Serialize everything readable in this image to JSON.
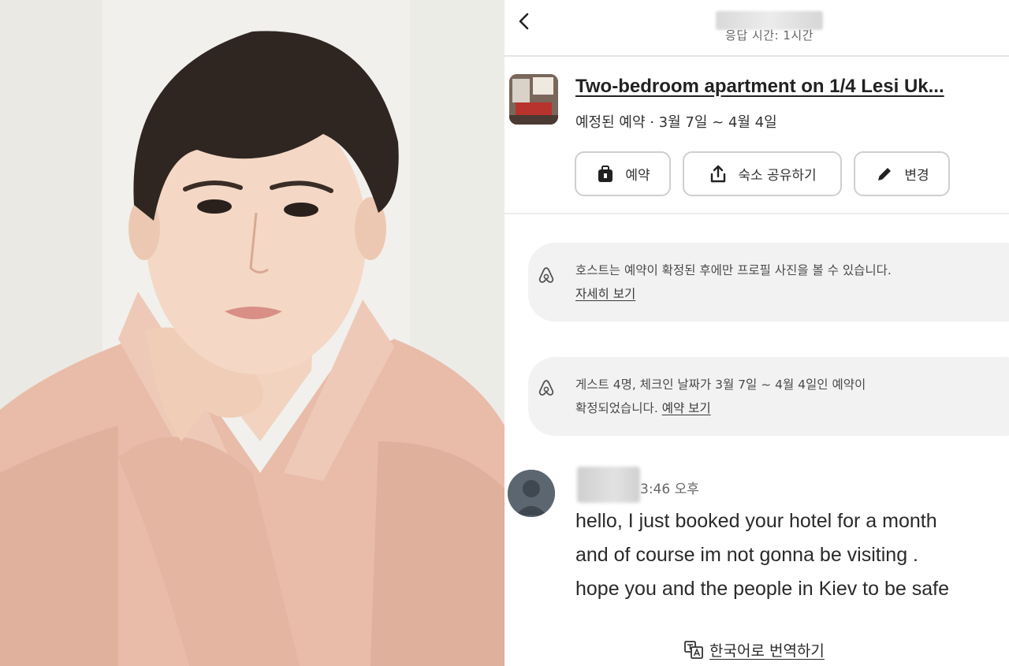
{
  "chat": {
    "response_time": "응답 시간: 1시간",
    "listing": {
      "title": "Two-bedroom apartment on 1/4 Lesi Uk...",
      "subtitle": "예정된 예약 · 3월 7일 ~ 4월 4일"
    },
    "actions": {
      "reserve_label": "예약",
      "share_label": "숙소 공유하기",
      "edit_label": "변경"
    },
    "notices": [
      {
        "text": "호스트는 예약이 확정된 후에만 프로필 사진을 볼 수 있습니다.",
        "link": "자세히 보기"
      },
      {
        "text_line1": "게스트 4명, 체크인 날짜가 3월 7일 ~ 4월 4일인 예약이",
        "text_line2": "확정되었습니다.",
        "link": "예약 보기"
      }
    ],
    "message": {
      "time": "3:46 오후",
      "lines": [
        "hello, I just booked your hotel for a month",
        "and of course im not gonna be visiting .",
        "hope you and the people in Kiev to be safe"
      ]
    },
    "translate_label": "한국어로 번역하기"
  },
  "icons": {
    "back": "chevron-left-icon",
    "reserve": "suitcase-icon",
    "share": "share-upload-icon",
    "edit": "pencil-icon",
    "notice": "airbnb-logo-icon",
    "translate": "translate-icon"
  },
  "colors": {
    "notice_bg": "#f2f2f2",
    "pill_border": "#cfcfcf",
    "text": "#222222",
    "shirt": "#e7bba9",
    "photo_bg": "#f3f2ee"
  }
}
